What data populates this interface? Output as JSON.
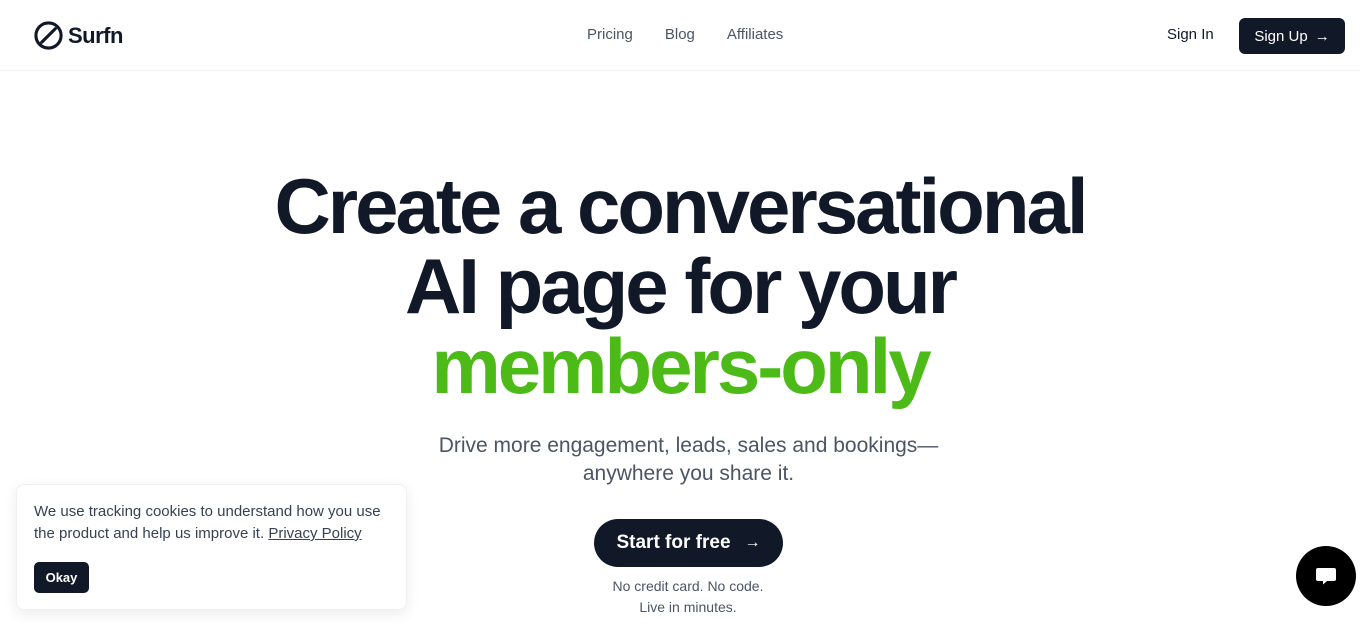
{
  "header": {
    "logo_text": "Surfn",
    "nav": [
      {
        "label": "Pricing"
      },
      {
        "label": "Blog"
      },
      {
        "label": "Affiliates"
      }
    ],
    "sign_in_label": "Sign In",
    "sign_up_label": "Sign Up",
    "sign_up_icon": "arrow-right-icon"
  },
  "hero": {
    "title_line1": "Create a conversational",
    "title_line2": "AI page for your",
    "title_accent": "members-only",
    "subtitle_line1": "Drive more engagement, leads, sales and bookings—",
    "subtitle_line2": "anywhere you share it.",
    "cta_label": "Start for free",
    "cta_icon": "arrow-right-icon",
    "cta_note_line1": "No credit card. No code.",
    "cta_note_line2": "Live in minutes."
  },
  "cookie_banner": {
    "text": "We use tracking cookies to understand how you use the product and help us improve it.",
    "link_label": "Privacy Policy",
    "button_label": "Okay"
  },
  "chat_widget": {
    "icon": "chat-bubble-icon"
  },
  "colors": {
    "primary": "#111827",
    "accent": "#4cbb17",
    "muted_text": "#4b5563",
    "background": "#ffffff"
  }
}
